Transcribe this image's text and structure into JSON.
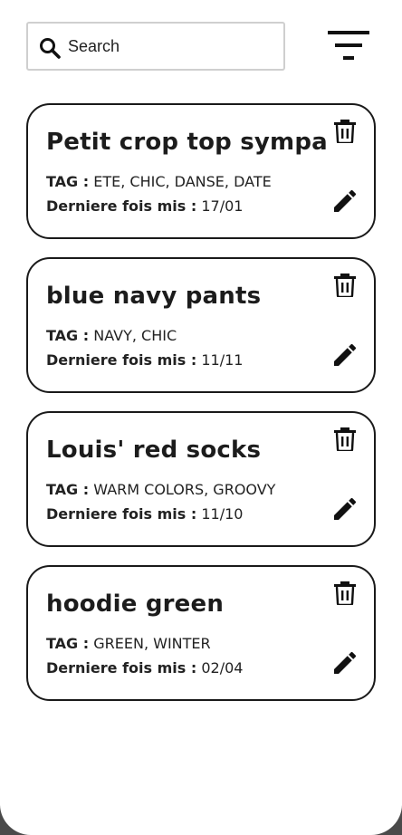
{
  "search": {
    "placeholder": "Search",
    "value": ""
  },
  "icons": {
    "search": "search-icon",
    "filter": "filter-icon",
    "delete": "trash-icon",
    "edit": "pencil-icon"
  },
  "labels": {
    "tag": "TAG :",
    "last_worn": "Derniere fois mis :"
  },
  "items": [
    {
      "title": "Petit crop top sympa",
      "tags": "ETE, CHIC, DANSE, DATE",
      "last_worn": "17/01"
    },
    {
      "title": "blue navy pants",
      "tags": "NAVY, CHIC",
      "last_worn": "11/11"
    },
    {
      "title": "Louis' red socks",
      "tags": "WARM COLORS, GROOVY",
      "last_worn": "11/10"
    },
    {
      "title": "hoodie green",
      "tags": "GREEN, WINTER",
      "last_worn": "02/04"
    }
  ]
}
